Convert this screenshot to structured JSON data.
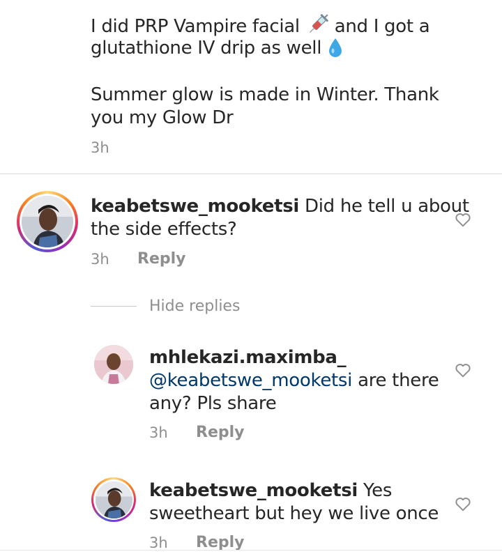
{
  "caption": {
    "line1_a": "I did PRP Vampire facial",
    "line1_b": "and I got a",
    "line2": "glutathione IV drip as well",
    "line3": "Summer glow is made in Winter. Thank",
    "line4": "you my Glow Dr",
    "time": "3h",
    "emoji_syringe": "syringe-icon",
    "emoji_droplet": "droplet-icon"
  },
  "comments": [
    {
      "username": "keabetswe_mooketsi",
      "text_line1": "Did he tell u about",
      "text_line2": "the side effects?",
      "time": "3h",
      "reply_label": "Reply"
    }
  ],
  "hide_replies_label": "Hide replies",
  "replies": [
    {
      "username": "mhlekazi.maximba_",
      "mention": "@keabetswe_mooketsi",
      "text_after_mention": "are there",
      "text_line2": "any? Pls share",
      "time": "3h",
      "reply_label": "Reply"
    },
    {
      "username": "keabetswe_mooketsi",
      "text_line1": "Yes",
      "text_line2": "sweetheart but hey we live once",
      "time": "3h",
      "reply_label": "Reply"
    }
  ],
  "colors": {
    "text": "#262626",
    "secondary": "#8e8e8e",
    "mention": "#00376b",
    "divider": "#dbdbdb"
  }
}
